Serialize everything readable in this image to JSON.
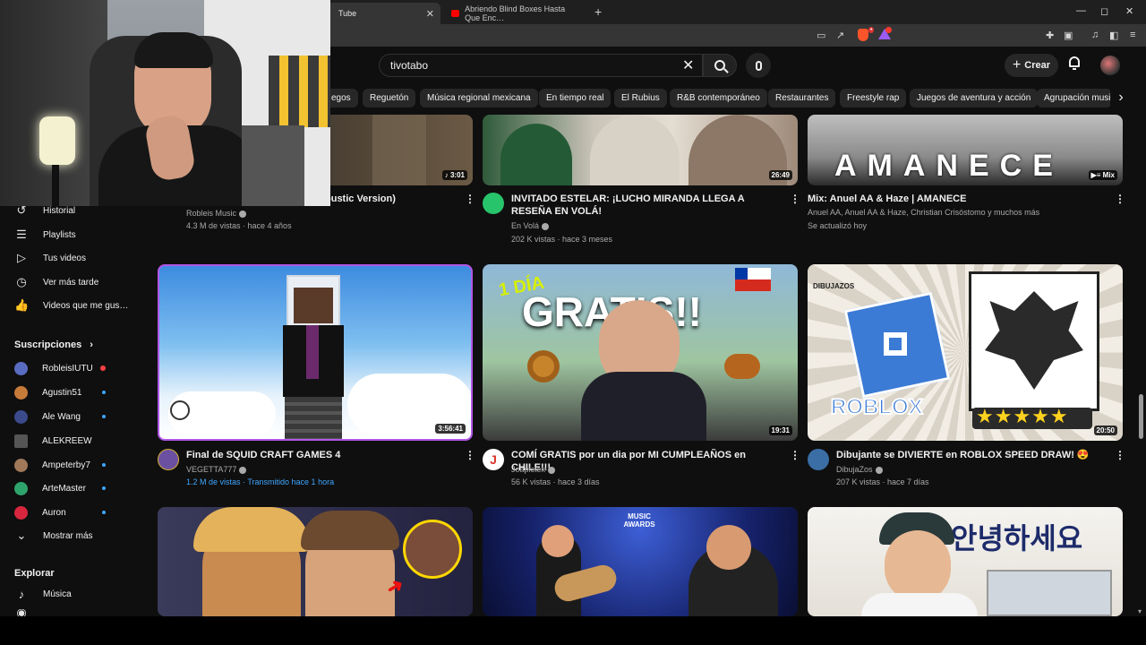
{
  "browser": {
    "tabs": [
      {
        "title": "Tube",
        "active": true
      },
      {
        "title": "Abriendo Blind Boxes Hasta Que Enc…",
        "active": false
      }
    ],
    "new_tab": "+",
    "window_controls": [
      "—",
      "◻",
      "✕"
    ]
  },
  "header": {
    "search_value": "tivotabo",
    "create_label": "Crear",
    "icons": [
      "clear-icon",
      "search-icon",
      "mic-icon",
      "bell-icon",
      "avatar"
    ]
  },
  "chips": [
    "…egos",
    "Reguetón",
    "Música regional mexicana",
    "En tiempo real",
    "El Rubius",
    "R&B contemporáneo",
    "Restaurantes",
    "Freestyle rap",
    "Juegos de aventura y acción",
    "Agrupación music…"
  ],
  "sidebar": {
    "you_items": [
      {
        "icon": "history-icon",
        "label": "Historial"
      },
      {
        "icon": "playlists-icon",
        "label": "Playlists"
      },
      {
        "icon": "your-videos-icon",
        "label": "Tus videos"
      },
      {
        "icon": "watch-later-icon",
        "label": "Ver más tarde"
      },
      {
        "icon": "liked-icon",
        "label": "Videos que me gus…"
      }
    ],
    "subs_title": "Suscripciones",
    "subs": [
      {
        "label": "RobleisIUTU",
        "color": "#5a6cbf",
        "status": "live"
      },
      {
        "label": "Agustin51",
        "color": "#c77b3a",
        "status": "new"
      },
      {
        "label": "Ale Wang",
        "color": "#3a4a8a",
        "status": "new"
      },
      {
        "label": "ALEKREEW",
        "color": "#555555",
        "status": "none"
      },
      {
        "label": "Ampeterby7",
        "color": "#a0785a",
        "status": "new"
      },
      {
        "label": "ArteMaster",
        "color": "#2ea36b",
        "status": "new"
      },
      {
        "label": "Auron",
        "color": "#d7263d",
        "status": "new"
      }
    ],
    "show_more": "Mostrar más",
    "explore_title": "Explorar",
    "explore_items": [
      {
        "icon": "music-icon",
        "label": "Música"
      }
    ]
  },
  "videos": [
    {
      "title": "…oustic Version)",
      "channel": "Robleis Music",
      "verified": true,
      "meta": "4.3 M de vistas · hace 4 años",
      "duration": "3:01",
      "avatar_color": "#444"
    },
    {
      "title": "INVITADO ESTELAR: ¡LUCHO MIRANDA LLEGA A RESEÑA EN VOLÁ!",
      "channel": "En Volá",
      "verified": true,
      "meta": "202 K vistas · hace 3 meses",
      "duration": "26:49",
      "avatar_color": "#27c46b"
    },
    {
      "title": "Mix: Anuel AA & Haze | AMANECE",
      "channel": "Anuel AA, Anuel AA & Haze, Christian Crisóstomo y muchos más",
      "verified": false,
      "meta": "Se actualizó hoy",
      "duration": "Mix",
      "avatar_color": ""
    },
    {
      "title": "Final de SQUID CRAFT GAMES 4",
      "channel": "VEGETTA777",
      "verified": true,
      "meta": "1.2 M de vistas · Transmitido hace 1 hora",
      "duration": "3:56:41",
      "avatar_color": "#6b4fa0",
      "meta_blue": true
    },
    {
      "title": "COMÍ GRATIS por un dia por MI CUMPLEAÑOS en CHILE!!!",
      "channel": "Joapictex",
      "verified": true,
      "meta": "56 K vistas · hace 3 días",
      "duration": "19:31",
      "avatar_color": "#d9362b"
    },
    {
      "title": "Dibujante se DIVIERTE en ROBLOX SPEED DRAW! 😍",
      "channel": "DibujaZos",
      "verified": true,
      "meta": "207 K vistas · hace 7 días",
      "duration": "20:50",
      "avatar_color": "#3a6ea5"
    }
  ],
  "thumb_texts": {
    "amanece": "AMANECE",
    "gratis": "GRATIS!!",
    "un_dia": "1 DÍA",
    "roblox": "ROBLOX",
    "korean": "안녕하세요",
    "dibujazos": "DIBUJAZOS",
    "music_awards": "MUSIC AWARDS"
  }
}
